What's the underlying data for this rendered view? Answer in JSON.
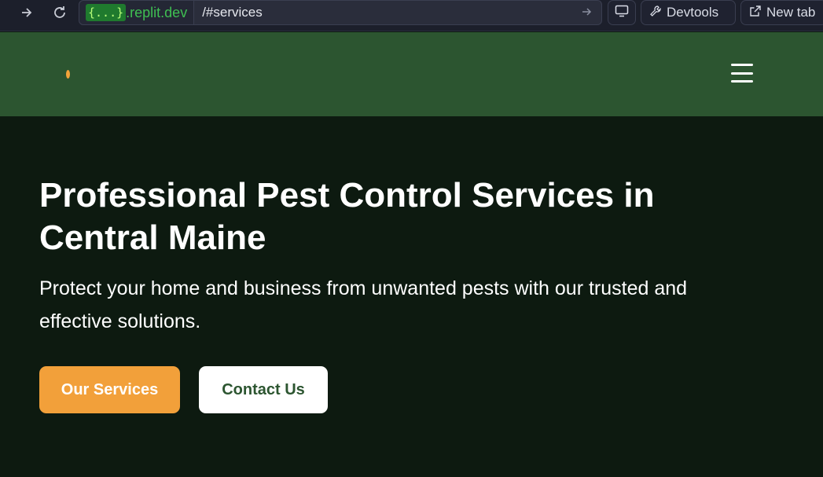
{
  "browser": {
    "url_braces": "{...}",
    "url_domain": ".replit.dev",
    "url_path": "/#services",
    "devtools_label": "Devtools",
    "new_tab_label": "New tab"
  },
  "header": {
    "menu_icon": "hamburger-menu-icon"
  },
  "hero": {
    "title": "Professional Pest Control Services in Central Maine",
    "subtitle": "Protect your home and business from unwanted pests with our trusted and effective solutions.",
    "primary_button": "Our Services",
    "secondary_button": "Contact Us"
  },
  "colors": {
    "header_bg": "#2c5530",
    "hero_bg": "#0d1a10",
    "accent": "#f2a03a"
  }
}
